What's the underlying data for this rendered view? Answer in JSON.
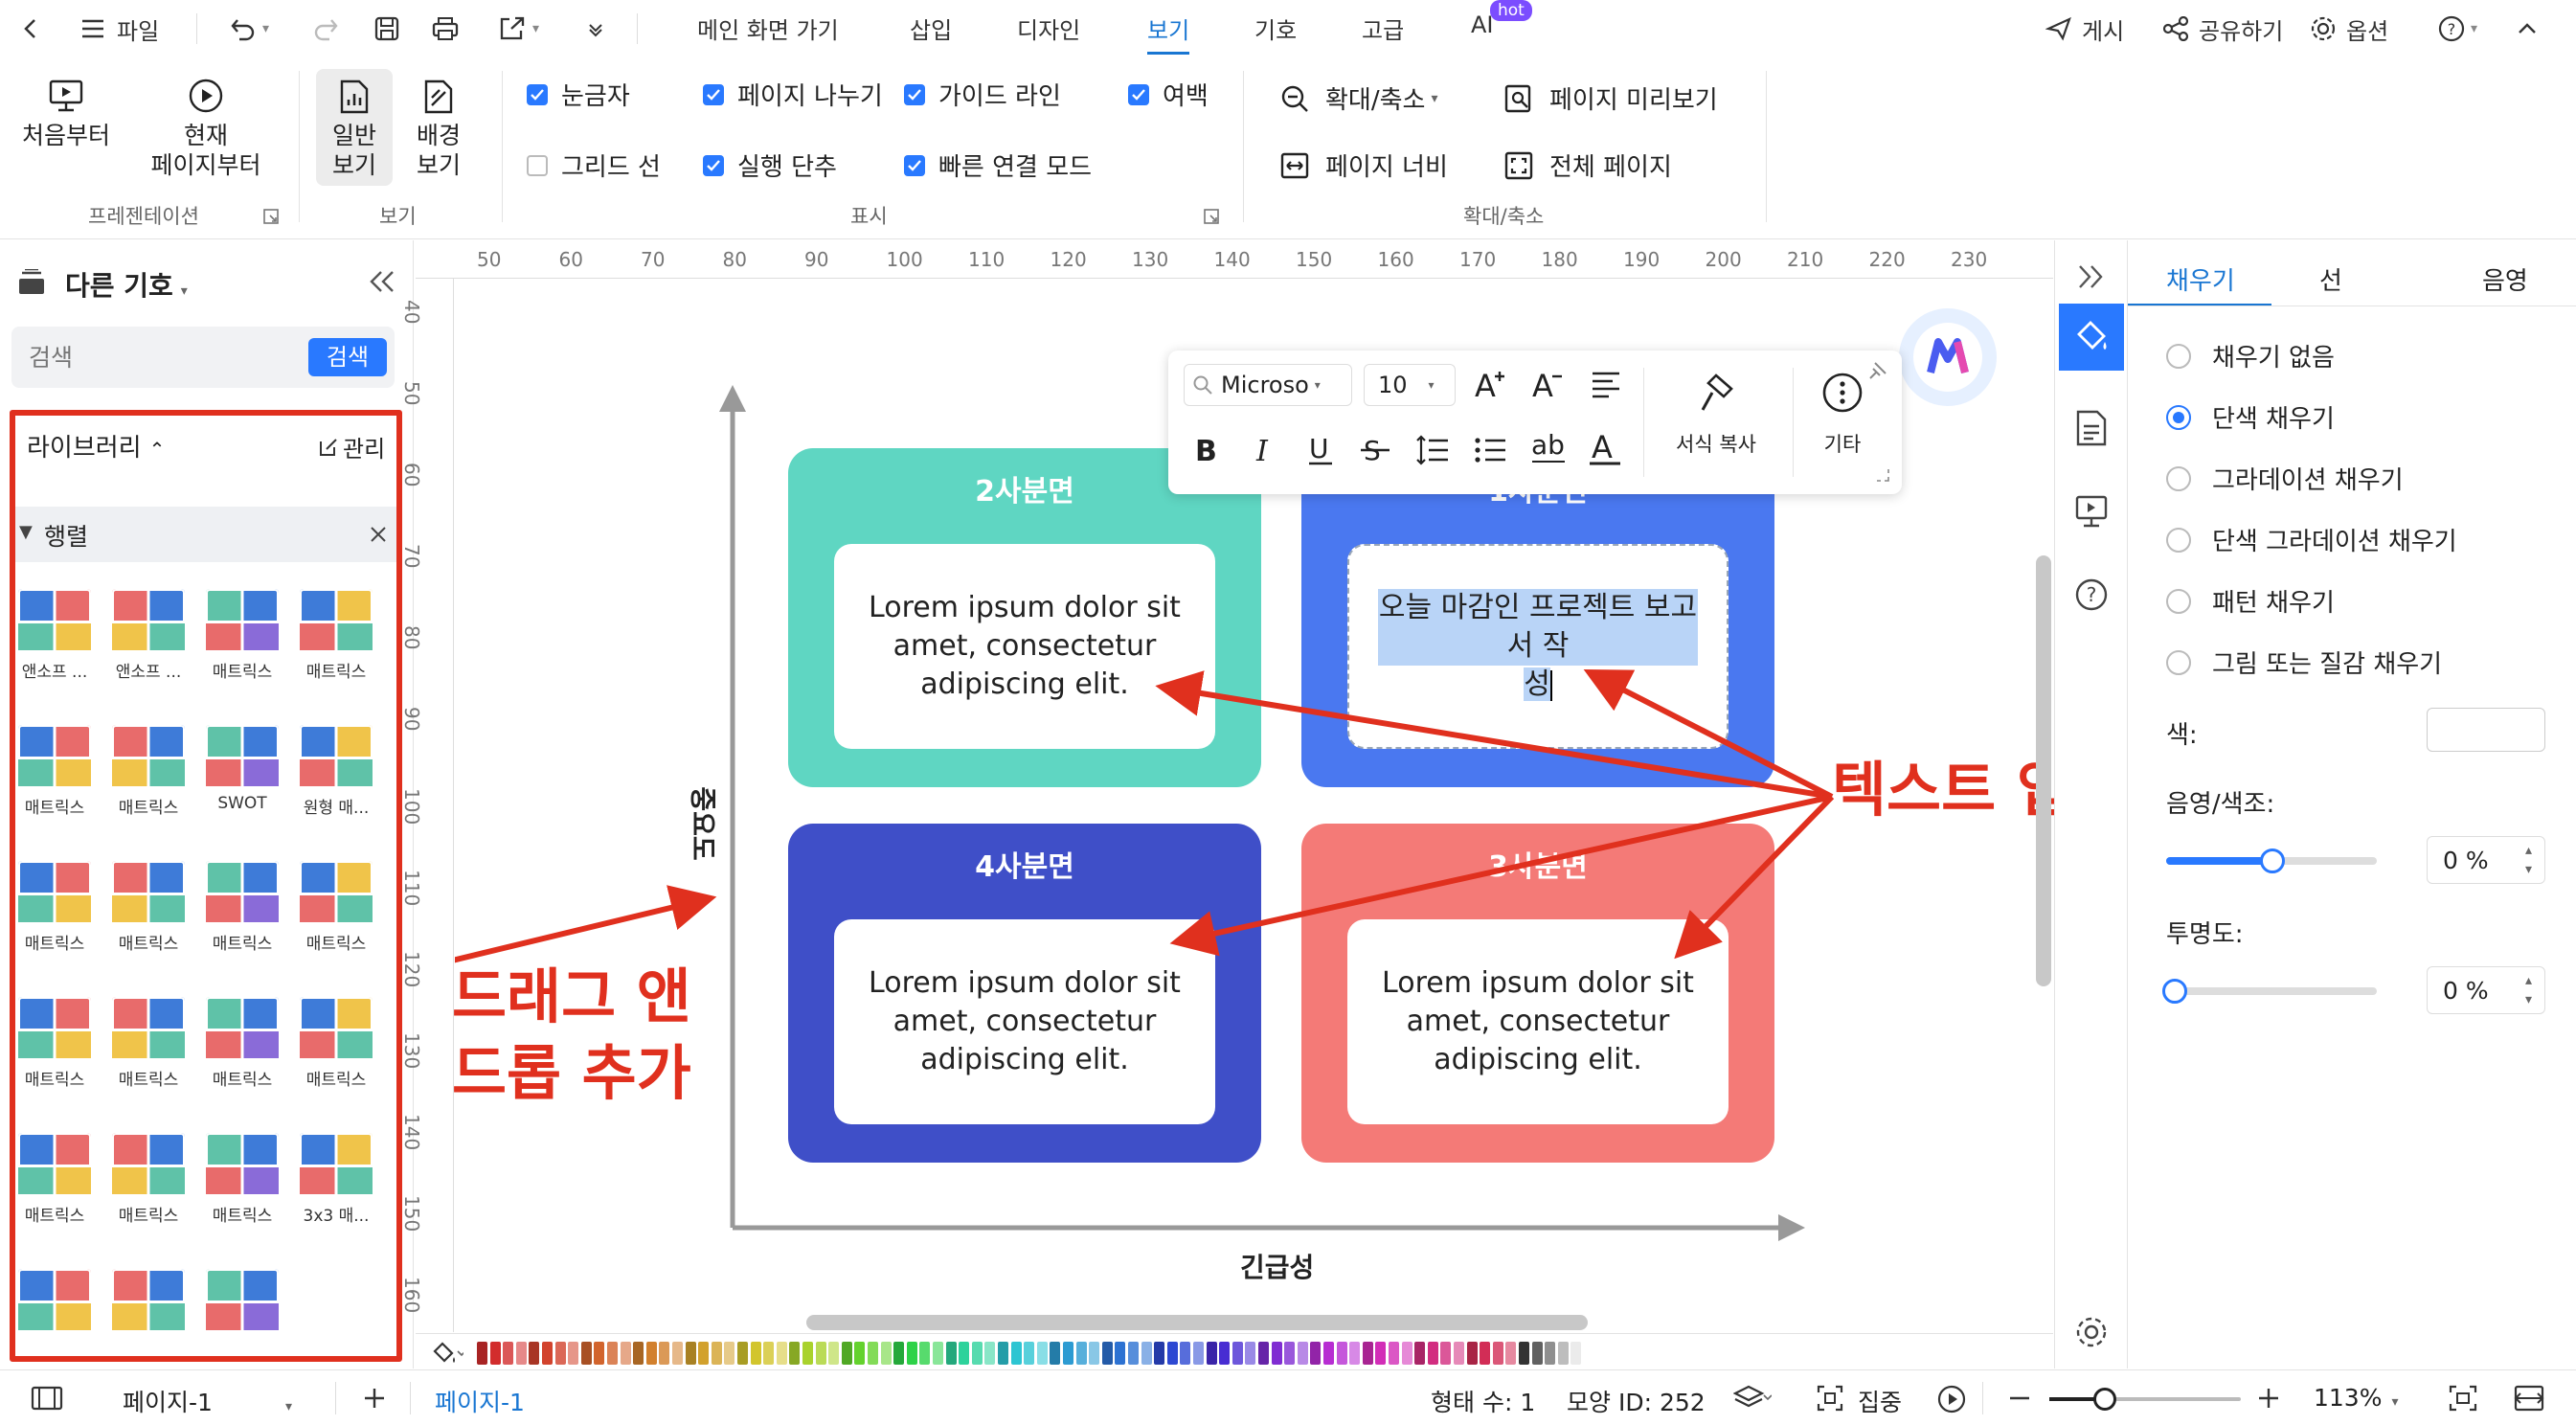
{
  "topbar": {
    "file_label": "파일",
    "tabs": [
      "메인 화면 가기",
      "삽입",
      "디자인",
      "보기",
      "기호",
      "고급",
      "AI"
    ],
    "active_tab": "보기",
    "ai_badge": "hot",
    "publish_label": "게시",
    "share_label": "공유하기",
    "options_label": "옵션"
  },
  "ribbon": {
    "presentation": {
      "from_start": "처음부터",
      "from_current_line1": "현재",
      "from_current_line2": "페이지부터",
      "group_label": "프레젠테이션"
    },
    "view": {
      "normal_line1": "일반",
      "normal_line2": "보기",
      "background_line1": "배경",
      "background_line2": "보기",
      "group_label": "보기"
    },
    "display": {
      "ruler": "눈금자",
      "page_break": "페이지 나누기",
      "guide_line": "가이드 라인",
      "margin": "여백",
      "grid_line": "그리드 선",
      "undo_step": "실행 단추",
      "quick_connect": "빠른 연결 모드",
      "group_label": "표시"
    },
    "zoom": {
      "zoom_menu": "확대/축소",
      "page_preview": "페이지 미리보기",
      "page_width": "페이지 너비",
      "whole_page": "전체 페이지",
      "group_label": "확대/축소"
    }
  },
  "left_panel": {
    "title": "다른 기호",
    "search_placeholder": "검색",
    "search_button": "검색",
    "library_label": "라이브러리",
    "manage_label": "관리",
    "section_label": "행렬",
    "items": [
      "앤소프 ...",
      "앤소프 ...",
      "매트릭스",
      "매트릭스",
      "매트릭스",
      "매트릭스",
      "SWOT",
      "원형 매...",
      "매트릭스",
      "매트릭스",
      "매트릭스",
      "매트릭스",
      "매트릭스",
      "매트릭스",
      "매트릭스",
      "매트릭스",
      "매트릭스",
      "매트릭스",
      "매트릭스",
      "3x3 매...",
      "",
      "",
      ""
    ]
  },
  "ruler": {
    "top_ticks": [
      "50",
      "60",
      "70",
      "80",
      "90",
      "100",
      "110",
      "120",
      "130",
      "140",
      "150",
      "160",
      "170",
      "180",
      "190",
      "200",
      "210",
      "220",
      "230"
    ],
    "left_ticks": [
      "40",
      "50",
      "60",
      "70",
      "80",
      "90",
      "100",
      "110",
      "120",
      "130",
      "140",
      "150",
      "160"
    ]
  },
  "diagram": {
    "y_axis_label": "중요도",
    "x_axis_label": "긴급성",
    "q2_title": "2사분면",
    "q2_text": "Lorem ipsum dolor sit amet, consectetur adipiscing elit.",
    "q1_title": "1사분면",
    "q1_text_line1": "오늘 마감인 프로젝트 보고서 작",
    "q1_text_line2": "성",
    "q4_title": "4사분면",
    "q4_text": "Lorem ipsum dolor sit amet, consectetur adipiscing elit.",
    "q3_title": "3사분면",
    "q3_text": "Lorem ipsum dolor sit amet, consectetur adipiscing elit.",
    "colors": {
      "q2": "#5fd6c2",
      "q1": "#4a78f0",
      "q4": "#3f4fc8",
      "q3": "#f47a77"
    }
  },
  "annotations": {
    "drag_line1": "드래그 앤",
    "drag_line2": "드롭 추가",
    "text_input": "텍스트 입력",
    "color": "#e0301e"
  },
  "float_toolbar": {
    "font": "Microso",
    "size": "10",
    "format_copy": "서식 복사",
    "more": "기타"
  },
  "right_panel": {
    "tabs": [
      "채우기",
      "선",
      "음영"
    ],
    "fill_options": [
      "채우기 없음",
      "단색 채우기",
      "그라데이션 채우기",
      "단색 그라데이션 채우기",
      "패턴 채우기",
      "그림 또는 질감 채우기"
    ],
    "selected_fill": "단색 채우기",
    "color_label": "색:",
    "shade_label": "음영/색조:",
    "shade_value": "0 %",
    "opacity_label": "투명도:",
    "opacity_value": "0 %"
  },
  "bottom_bar": {
    "page_select": "페이지-1",
    "page_tab": "페이지-1",
    "shape_count": "형태 수: 1",
    "shape_id": "모양 ID: 252",
    "focus_label": "집중",
    "zoom_value": "113%"
  }
}
